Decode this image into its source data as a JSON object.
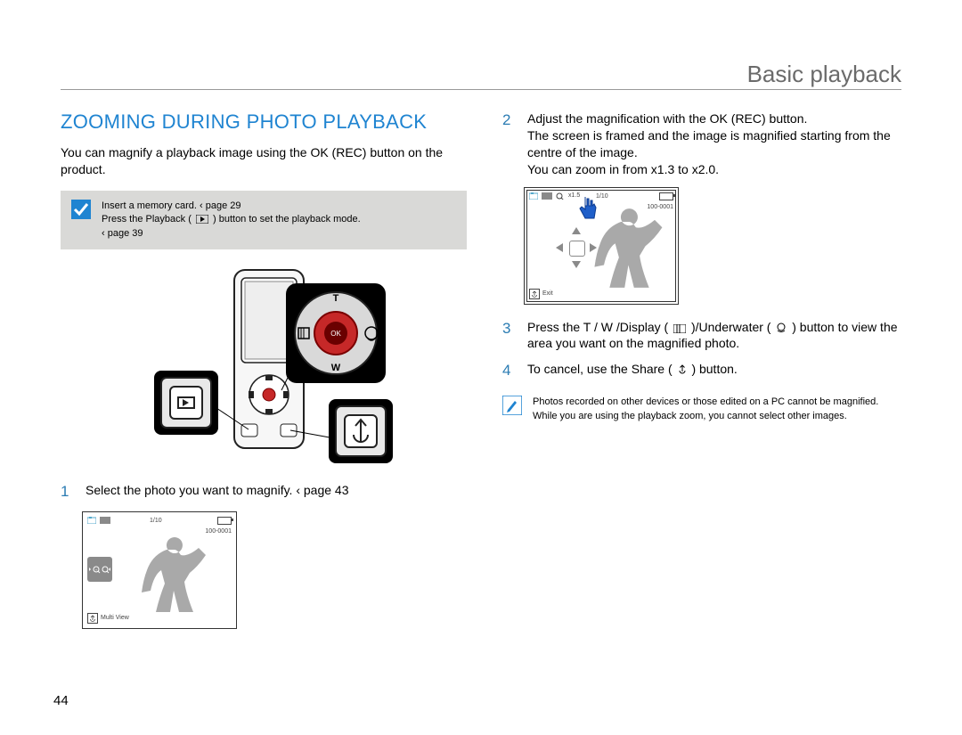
{
  "header": {
    "breadcrumb": "Basic playback"
  },
  "page_number": "44",
  "left": {
    "section_title": "ZOOMING DURING PHOTO PLAYBACK",
    "intro": "You can magnify a playback image using the OK (REC) button on the product.",
    "note": {
      "line1": "Insert a memory card. ‹ page 29",
      "line2a": "Press the Playback (",
      "line2b": ") button to set the playback mode.",
      "line3": "‹ page 39"
    },
    "step1": {
      "num": "1",
      "text": "Select the photo you want to magnify. ‹ page 43"
    },
    "screen1": {
      "count": "1/10",
      "file": "100-0001",
      "footer": "Multi View"
    }
  },
  "right": {
    "step2": {
      "num": "2",
      "text1": "Adjust the magnification with the OK (REC) button.",
      "text2": "The screen is framed and the image is magnified starting from the centre of the image.",
      "text3": "You can zoom in from x1.3 to x2.0."
    },
    "screen2": {
      "zoom": "x1.5",
      "count": "1/10",
      "file": "100-0001",
      "footer": "Exit"
    },
    "step3": {
      "num": "3",
      "text_a": "Press the T / W /Display (",
      "text_b": ")/Underwater (",
      "text_c": ") button to view the area you want on the magnified photo."
    },
    "step4": {
      "num": "4",
      "text_a": "To cancel, use the Share (",
      "text_b": ") button."
    },
    "note": {
      "line1": "Photos recorded on other devices or those edited on a PC cannot be magnified.",
      "line2": "While you are using the playback zoom, you cannot select other images."
    }
  }
}
